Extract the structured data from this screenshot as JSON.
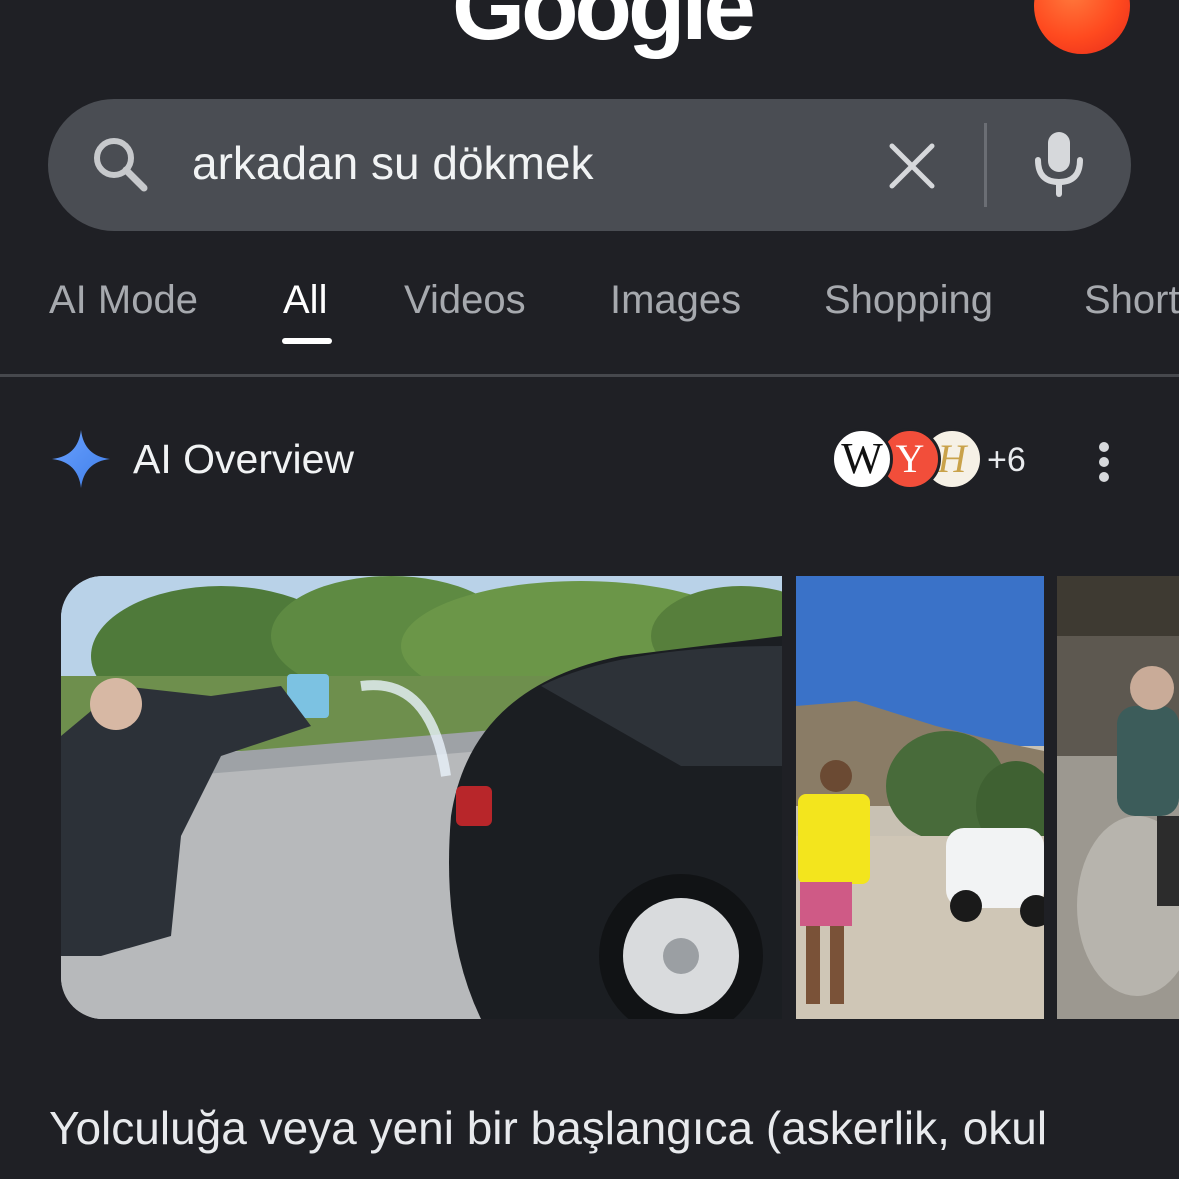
{
  "header": {
    "logo_text": "Google"
  },
  "search": {
    "query": "arkadan su dökmek"
  },
  "tabs": [
    {
      "label": "AI Mode",
      "active": false
    },
    {
      "label": "All",
      "active": true
    },
    {
      "label": "Videos",
      "active": false
    },
    {
      "label": "Images",
      "active": false
    },
    {
      "label": "Shopping",
      "active": false
    },
    {
      "label": "Short",
      "active": false
    }
  ],
  "ai_overview": {
    "title": "AI Overview",
    "sources": {
      "icons": [
        "W",
        "Y",
        "H"
      ],
      "more_count": "+6"
    },
    "body_text": "Yolculuğa veya yeni bir başlangıca (askerlik, okul"
  },
  "colors": {
    "background": "#1f2025",
    "search_bar": "#4a4d53",
    "sparkle": "#4f8df5",
    "avatar": "#ff4a1f"
  }
}
